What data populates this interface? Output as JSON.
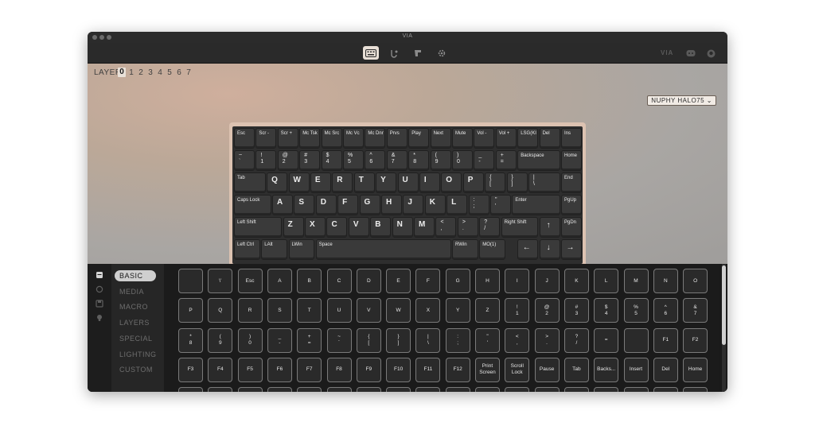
{
  "window": {
    "title": "VIA"
  },
  "toolbar": {
    "right_logo": "VIA"
  },
  "layers": {
    "label": "LAYER",
    "numbers": [
      "0",
      "1",
      "2",
      "3",
      "4",
      "5",
      "6",
      "7"
    ],
    "active": "0"
  },
  "keyboard_select": {
    "value": "NUPHY HALO75 ⌄"
  },
  "keyboard": {
    "row0": [
      "Esc",
      "Scr -",
      "Scr +",
      "Mc Tsk",
      "Mc Src",
      "Mc Vc",
      "Mc Dnr",
      "Prvs",
      "Play",
      "Next",
      "Mute",
      "Vol -",
      "Vol +",
      "LSG(KI",
      "Del",
      "Ins"
    ],
    "row1": [
      "~\n`",
      "!\n1",
      "@\n2",
      "#\n3",
      "$\n4",
      "%\n5",
      "^\n6",
      "&\n7",
      "*\n8",
      "(\n9",
      ")\n0",
      "_\n-",
      "+\n=",
      "Backspace",
      "Home"
    ],
    "row2": [
      "Tab",
      "Q",
      "W",
      "E",
      "R",
      "T",
      "Y",
      "U",
      "I",
      "O",
      "P",
      "{\n[",
      "}\n]",
      "|\n\\",
      "End"
    ],
    "row3": [
      "Caps Lock",
      "A",
      "S",
      "D",
      "F",
      "G",
      "H",
      "J",
      "K",
      "L",
      ":\n;",
      "\"\n'",
      "Enter",
      "PgUp"
    ],
    "row4": [
      "Left Shift",
      "Z",
      "X",
      "C",
      "V",
      "B",
      "N",
      "M",
      "<\n,",
      ">\n.",
      "?\n/",
      "Right Shift",
      "↑",
      "PgDn"
    ],
    "row5": [
      "Left Ctrl",
      "LAlt",
      "LWin",
      "Space",
      "RWin",
      "MO(1)",
      "",
      "←",
      "↓",
      "→"
    ]
  },
  "categories": [
    "BASIC",
    "MEDIA",
    "MACRO",
    "LAYERS",
    "SPECIAL",
    "LIGHTING",
    "CUSTOM"
  ],
  "active_category": "BASIC",
  "basic_keys": {
    "row0": [
      "",
      "\\'",
      "Esc",
      "A",
      "B",
      "C",
      "D",
      "E",
      "F",
      "G",
      "H",
      "I",
      "J",
      "K",
      "L",
      "M",
      "N",
      "O"
    ],
    "row1": [
      "P",
      "Q",
      "R",
      "S",
      "T",
      "U",
      "V",
      "W",
      "X",
      "Y",
      "Z",
      "!\n1",
      "@\n2",
      "#\n3",
      "$\n4",
      "%\n5",
      "^\n6",
      "&\n7"
    ],
    "row2": [
      "*\n8",
      "(\n9",
      ")\n0",
      "_\n-",
      "+\n=",
      "~\n`",
      "{\n[",
      "}\n]",
      "|\n\\",
      ":\n;",
      "\"\n'",
      "<\n,",
      ">\n.",
      "?\n/",
      "=",
      "",
      "F1",
      "F2"
    ],
    "row3": [
      "F3",
      "F4",
      "F5",
      "F6",
      "F7",
      "F8",
      "F9",
      "F10",
      "F11",
      "F12",
      "Print\nScreen",
      "Scroll\nLock",
      "Pause",
      "Tab",
      "Backs...",
      "Insert",
      "Del",
      "Home"
    ]
  }
}
